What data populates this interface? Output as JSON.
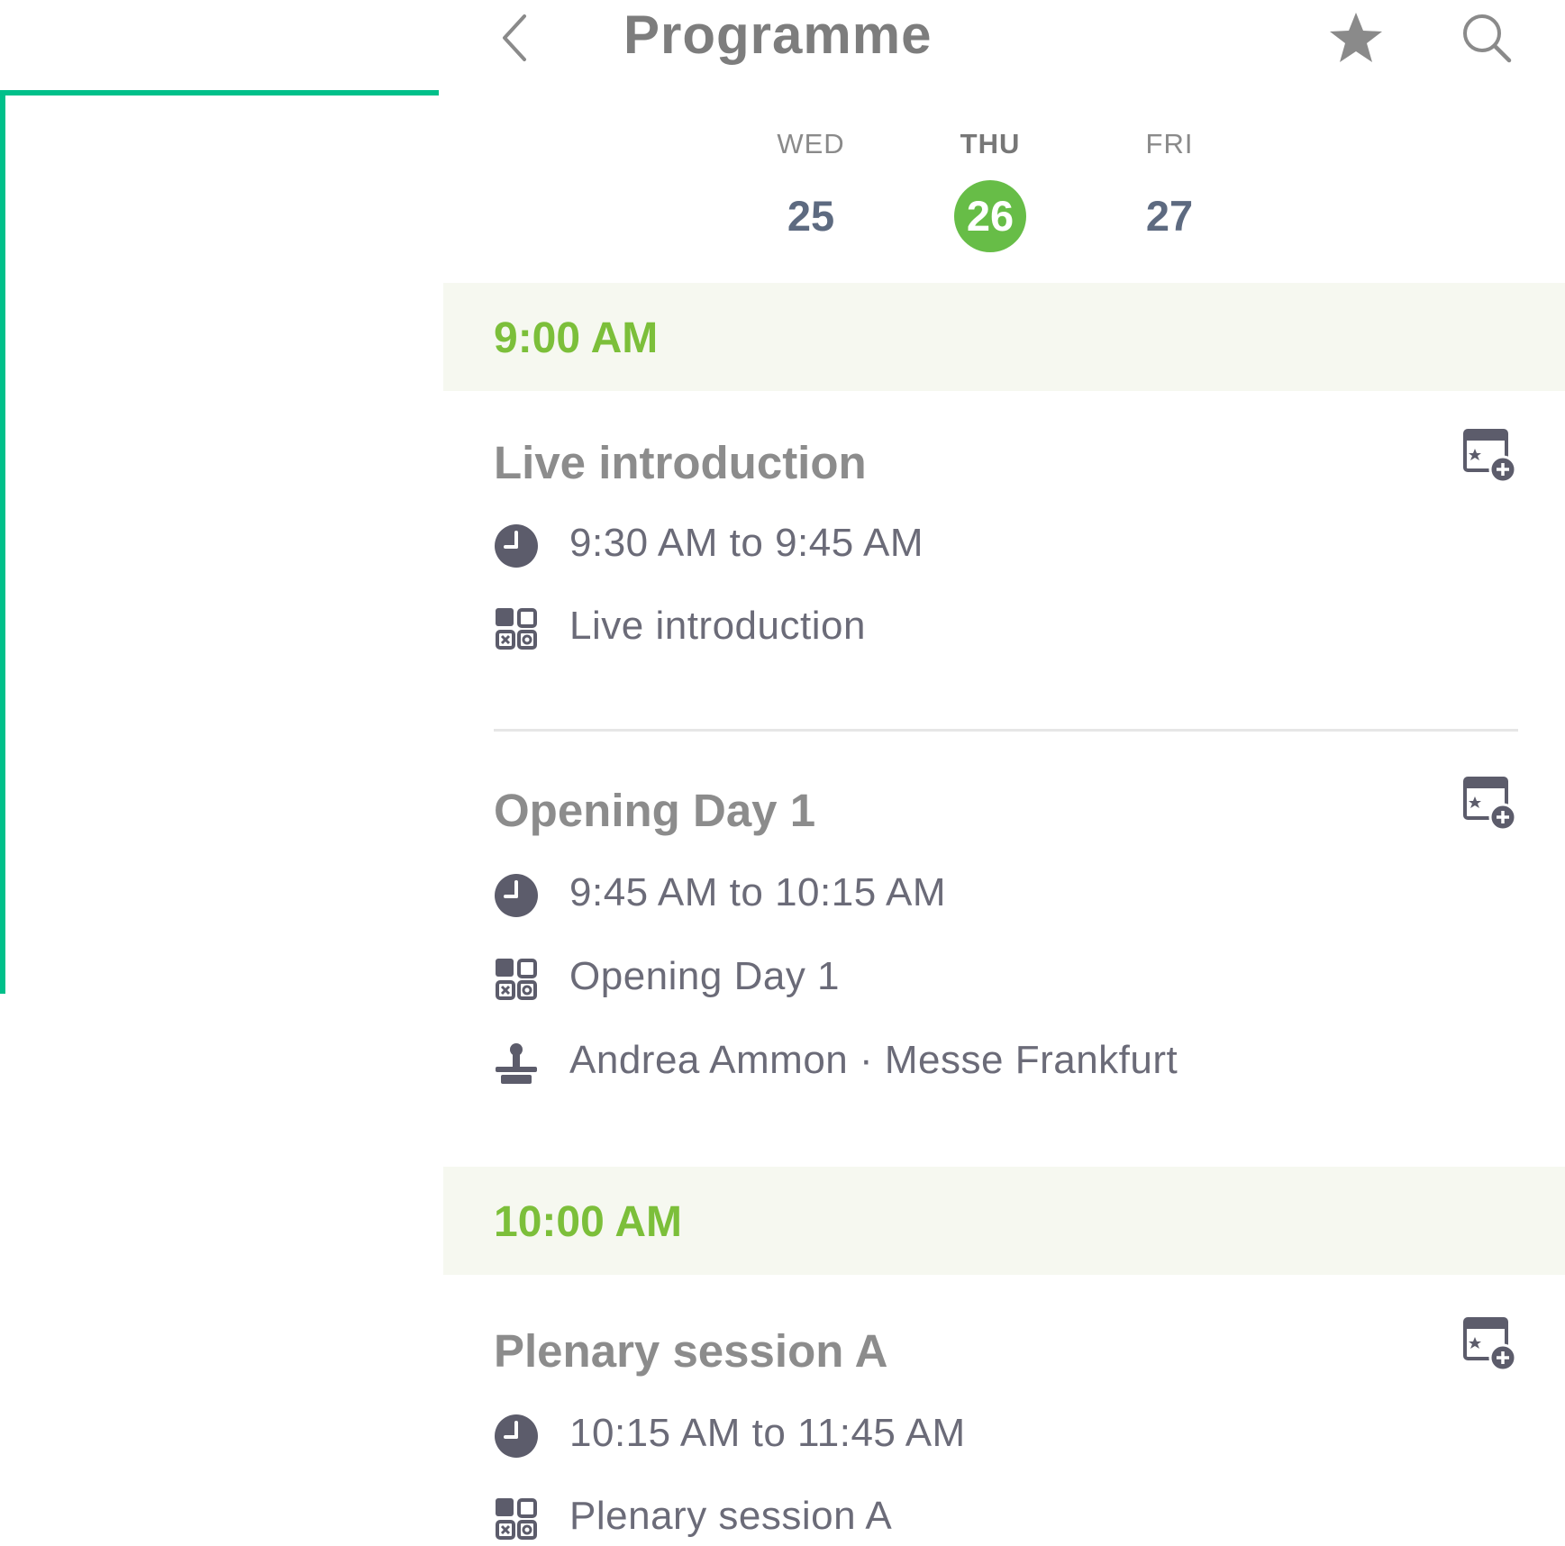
{
  "header": {
    "title": "Programme"
  },
  "days": [
    {
      "dow": "WED",
      "num": "25",
      "selected": false
    },
    {
      "dow": "THU",
      "num": "26",
      "selected": true
    },
    {
      "dow": "FRI",
      "num": "27",
      "selected": false
    }
  ],
  "slots": [
    {
      "time": "9:00 AM",
      "sessions": [
        {
          "title": "Live introduction",
          "time_range": "9:30 AM to 9:45 AM",
          "category": "Live introduction"
        },
        {
          "title": "Opening Day 1",
          "time_range": "9:45 AM to 10:15 AM",
          "category": "Opening Day 1",
          "speaker": "Andrea Ammon · Messe Frankfurt"
        }
      ]
    },
    {
      "time": "10:00 AM",
      "sessions": [
        {
          "title": "Plenary session A",
          "time_range": "10:15 AM to 11:45 AM",
          "category": "Plenary session A"
        }
      ]
    }
  ],
  "colors": {
    "accent_green": "#67bd47",
    "time_green": "#7cbf3a",
    "callout": "#00c08a",
    "icon_gray": "#5c5c6b"
  },
  "icons": [
    "back-chevron",
    "star",
    "search",
    "calendar-add",
    "clock",
    "category-grid",
    "speaker"
  ]
}
